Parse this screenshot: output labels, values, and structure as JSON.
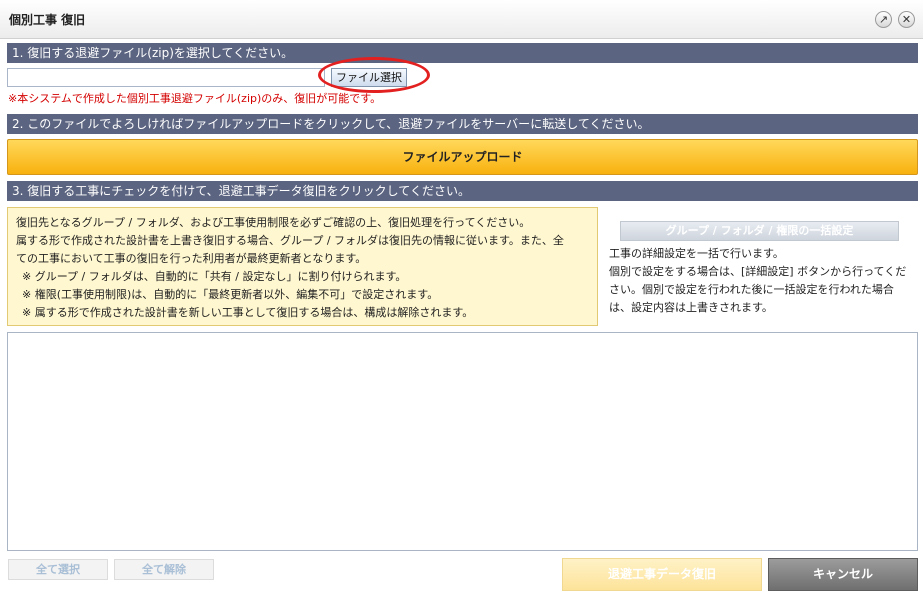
{
  "window": {
    "title": "個別工事 復旧",
    "popout_icon": "↗",
    "close_icon": "✕"
  },
  "step1": {
    "header": "1. 復旧する退避ファイル(zip)を選択してください。",
    "file_value": "",
    "file_button": "ファイル選択",
    "note": "※本システムで作成した個別工事退避ファイル(zip)のみ、復旧が可能です。"
  },
  "step2": {
    "header": "2. このファイルでよろしければファイルアップロードをクリックして、退避ファイルをサーバーに転送してください。",
    "upload_button": "ファイルアップロード"
  },
  "step3": {
    "header": "3. 復旧する工事にチェックを付けて、退避工事データ復旧をクリックしてください。",
    "info_lines": [
      "復旧先となるグループ / フォルダ、および工事使用制限を必ずご確認の上、復旧処理を行ってください。",
      "属する形で作成された設計書を上書き復旧する場合、グループ / フォルダは復旧先の情報に従います。また、全",
      "ての工事において工事の復旧を行った利用者が最終更新者となります。",
      "※ グループ / フォルダは、自動的に「共有 / 設定なし」に割り付けられます。",
      "※ 権限(工事使用制限)は、自動的に「最終更新者以外、編集不可」で設定されます。",
      "※ 属する形で作成された設計書を新しい工事として復旧する場合は、構成は解除されます。"
    ],
    "bulk_button": "グループ / フォルダ / 権限の一括設定",
    "bulk_desc_lines": [
      "工事の詳細設定を一括で行います。",
      "個別で設定をする場合は、[詳細設定] ボタンから行ってくだ",
      "さい。個別で設定を行われた後に一括設定を行われた場合",
      "は、設定内容は上書きされます。"
    ]
  },
  "footer": {
    "select_all": "全て選択",
    "deselect_all": "全て解除",
    "restore_button": "退避工事データ復旧",
    "cancel_button": "キャンセル"
  },
  "colors": {
    "section_header": "#5b6480",
    "upload_button": "#f8b10e",
    "info_box": "#fff7cf",
    "note_red": "#d40000",
    "annotation_oval": "#e32020"
  }
}
